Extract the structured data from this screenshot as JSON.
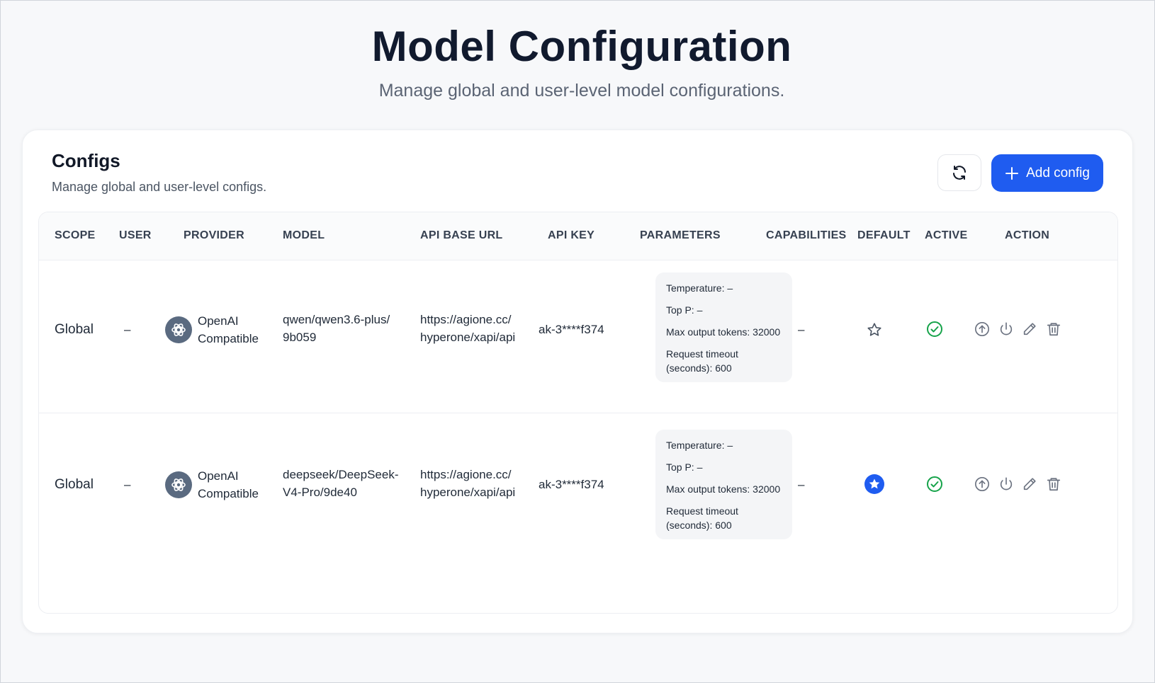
{
  "page": {
    "title": "Model Configuration",
    "subtitle": "Manage global and user-level model configurations."
  },
  "card": {
    "title": "Configs",
    "subtitle": "Manage global and user-level configs.",
    "refresh_icon": "refresh-icon",
    "add_button_label": "Add config",
    "add_icon": "plus-icon"
  },
  "table": {
    "headers": {
      "scope": "SCOPE",
      "user": "USER",
      "provider": "PROVIDER",
      "model": "MODEL",
      "api_base_url": "API BASE URL",
      "api_key": "API KEY",
      "parameters": "PARAMETERS",
      "capabilities": "CAPABILITIES",
      "default": "DEFAULT",
      "active": "ACTIVE",
      "action": "ACTION"
    },
    "rows": [
      {
        "scope": "Global",
        "user": "–",
        "provider_line1": "OpenAI",
        "provider_line2": "Compatible",
        "provider_icon": "openai-icon",
        "model_line1": "qwen/qwen3.6-plus/",
        "model_line2": "9b059",
        "url_line1": "https://agione.cc/",
        "url_line2": "hyperone/xapi/api",
        "api_key": "ak-3****f374",
        "params": {
          "temperature": "Temperature: –",
          "top_p": "Top P: –",
          "max_tokens": "Max output tokens: 32000",
          "timeout_line1": "Request timeout",
          "timeout_line2": "(seconds): 600"
        },
        "capabilities": "–",
        "is_default": false,
        "is_active": true
      },
      {
        "scope": "Global",
        "user": "–",
        "provider_line1": "OpenAI",
        "provider_line2": "Compatible",
        "provider_icon": "openai-icon",
        "model_line1": "deepseek/DeepSeek-",
        "model_line2": "V4-Pro/9de40",
        "url_line1": "https://agione.cc/",
        "url_line2": "hyperone/xapi/api",
        "api_key": "ak-3****f374",
        "params": {
          "temperature": "Temperature: –",
          "top_p": "Top P: –",
          "max_tokens": "Max output tokens: 32000",
          "timeout_line1": "Request timeout",
          "timeout_line2": "(seconds): 600"
        },
        "capabilities": "–",
        "is_default": true,
        "is_active": true
      }
    ],
    "action_icons": [
      "upload-icon",
      "power-icon",
      "edit-icon",
      "trash-icon"
    ]
  },
  "colors": {
    "primary": "#1f5cf0",
    "active_green": "#16a34a",
    "icon_gray": "#6b7280",
    "provider_icon_bg": "#5a6a80"
  }
}
